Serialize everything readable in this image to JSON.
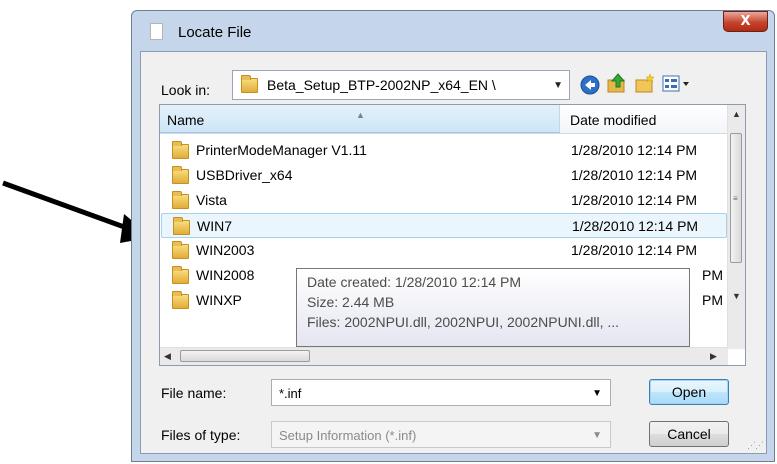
{
  "dialog": {
    "title": "Locate File",
    "close_label": "X"
  },
  "toolbar": {
    "look_in_label": "Look in:",
    "look_in_value": "Beta_Setup_BTP-2002NP_x64_EN \\",
    "back_icon": "back-arrow-icon",
    "up_icon": "up-folder-icon",
    "new_folder_icon": "new-folder-icon",
    "view_icon": "view-menu-icon"
  },
  "file_list": {
    "columns": [
      "Name",
      "Date modified"
    ],
    "rows": [
      {
        "name": "PrinterModeManager V1.11",
        "date": "1/28/2010 12:14 PM"
      },
      {
        "name": "USBDriver_x64",
        "date": "1/28/2010 12:14 PM"
      },
      {
        "name": "Vista",
        "date": "1/28/2010 12:14 PM"
      },
      {
        "name": "WIN7",
        "date": "1/28/2010 12:14 PM",
        "selected": true
      },
      {
        "name": "WIN2003",
        "date": "1/28/2010 12:14 PM"
      },
      {
        "name": "WIN2008",
        "date": "PM"
      },
      {
        "name": "WINXP",
        "date": "PM"
      }
    ]
  },
  "tooltip": {
    "line1": "Date created: 1/28/2010 12:14 PM",
    "line2": "Size: 2.44 MB",
    "line3": "Files: 2002NPUI.dll, 2002NPUI, 2002NPUNI.dll, ..."
  },
  "form": {
    "file_name_label": "File name:",
    "file_name_value": "*.inf",
    "file_type_label": "Files of type:",
    "file_type_value": "Setup Information (*.inf)",
    "open_label": "Open",
    "cancel_label": "Cancel"
  },
  "colors": {
    "frame": "#c6d6ea",
    "close_button": "#c7432d",
    "selection": "#eaf5fc"
  }
}
